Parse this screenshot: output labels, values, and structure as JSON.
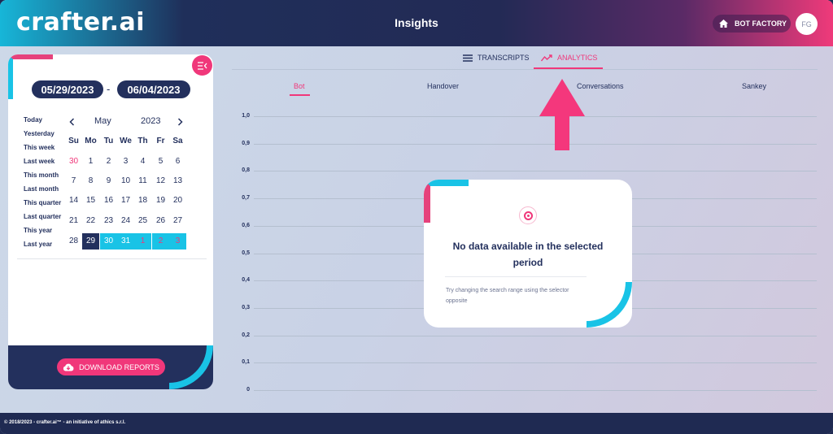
{
  "header": {
    "logo": "crafter.ai",
    "title": "Insights",
    "bot_factory_label": "BOT FACTORY",
    "avatar_initials": "FG"
  },
  "left_panel": {
    "date_from": "05/29/2023",
    "date_to": "06/04/2023",
    "date_separator": "-",
    "presets": [
      "Today",
      "Yesterday",
      "This week",
      "Last week",
      "This month",
      "Last month",
      "This quarter",
      "Last quarter",
      "This year",
      "Last year"
    ],
    "calendar": {
      "month": "May",
      "year": "2023",
      "prev_icon": "chevron-left-icon",
      "next_icon": "chevron-right-icon",
      "weekdays": [
        "Su",
        "Mo",
        "Tu",
        "We",
        "Th",
        "Fr",
        "Sa"
      ],
      "weeks": [
        [
          "30",
          "1",
          "2",
          "3",
          "4",
          "5",
          "6"
        ],
        [
          "7",
          "8",
          "9",
          "10",
          "11",
          "12",
          "13"
        ],
        [
          "14",
          "15",
          "16",
          "17",
          "18",
          "19",
          "20"
        ],
        [
          "21",
          "22",
          "23",
          "24",
          "25",
          "26",
          "27"
        ],
        [
          "28",
          "29",
          "30",
          "31",
          "1",
          "2",
          "3"
        ]
      ]
    },
    "download_label": "DOWNLOAD REPORTS",
    "accent_color": "#f0377a",
    "range_color": "#19c3e6"
  },
  "tabs": {
    "transcripts": "TRANSCRIPTS",
    "analytics": "ANALYTICS"
  },
  "subtabs": [
    "Bot",
    "Handover",
    "Conversations",
    "Sankey"
  ],
  "chart": {
    "y_ticks": [
      "1,0",
      "0,9",
      "0,8",
      "0,7",
      "0,6",
      "0,5",
      "0,4",
      "0,3",
      "0,2",
      "0,1",
      "0"
    ]
  },
  "empty_state": {
    "title": "No data available in the selected period",
    "subtitle": "Try changing the search range using the selector opposite"
  },
  "footer": {
    "text": "© 2018/2023 - crafter.ai™ - an initiative of athics s.r.l."
  }
}
